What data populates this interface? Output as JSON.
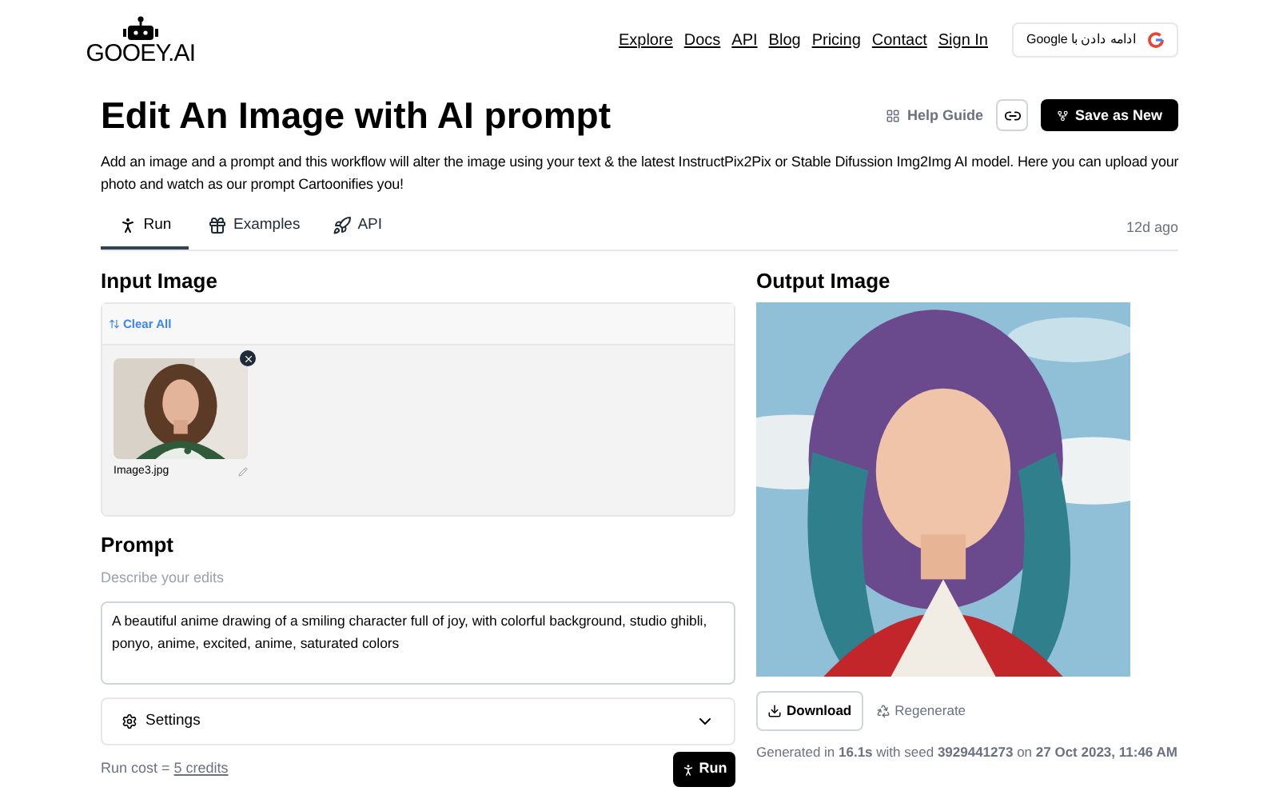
{
  "header": {
    "logo": "GOOEY.AI",
    "nav": [
      "Explore",
      "Docs",
      "API",
      "Blog",
      "Pricing",
      "Contact",
      "Sign In"
    ],
    "google_button": "ادامه دادن با Google"
  },
  "page": {
    "title": "Edit An Image with AI prompt",
    "help": "Help Guide",
    "save": "Save as New",
    "description": "Add an image and a prompt and this workflow will alter the image using your text & the latest InstructPix2Pix or Stable Difussion Img2Img AI model. Here you can upload your photo and watch as our prompt Cartoonifies you!"
  },
  "tabs": [
    {
      "label": "Run",
      "kind": "run",
      "selected": true
    },
    {
      "label": "Examples",
      "kind": "examples",
      "selected": false
    },
    {
      "label": "API",
      "kind": "api",
      "selected": false
    }
  ],
  "updated": "12d ago",
  "input": {
    "heading": "Input Image",
    "clear": "Clear All",
    "file": {
      "name": "Image3.jpg"
    }
  },
  "prompt": {
    "heading": "Prompt",
    "hint": "Describe your edits",
    "value": "A beautiful anime drawing of a smiling character full of joy, with colorful background, studio ghibli, ponyo, anime, excited, anime, saturated colors"
  },
  "settings": {
    "label": "Settings",
    "expanded": false
  },
  "run_cost": {
    "label": "Run cost = ",
    "link": "5 credits"
  },
  "run_button": "Run",
  "output": {
    "heading": "Output Image",
    "download": "Download",
    "regenerate": "Regenerate",
    "info": "Generated in **16.1s** with seed **3929441273** on **27 Oct 2023, 11:46 AM**"
  }
}
